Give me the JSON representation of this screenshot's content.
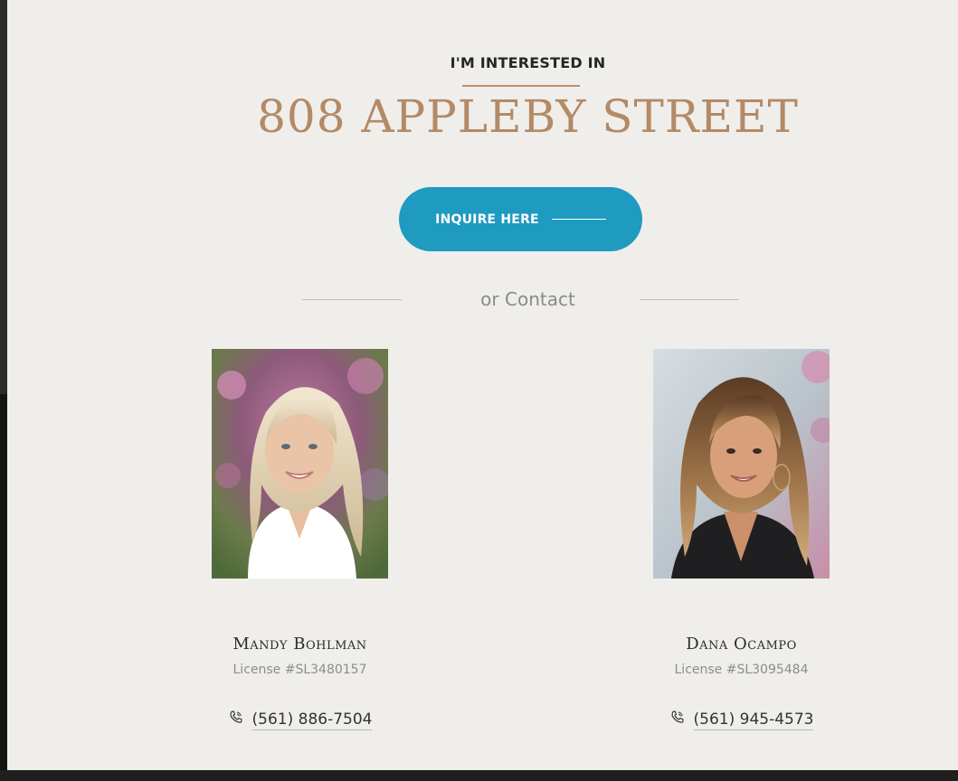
{
  "header": {
    "eyebrow": "I'M INTERESTED IN",
    "address": "808 APPLEBY STREET"
  },
  "cta": {
    "inquire_label": "INQUIRE HERE",
    "divider_label": "or Contact"
  },
  "colors": {
    "accent_gold": "#b38a66",
    "button_blue": "#1f9ac0",
    "panel_bg": "#efeeeb"
  },
  "agents": [
    {
      "name": "Mandy Bohlman",
      "license": "License #SL3480157",
      "phone": "(561) 886-7504",
      "phone_icon": "phone-icon"
    },
    {
      "name": "Dana Ocampo",
      "license": "License #SL3095484",
      "phone": "(561) 945-4573",
      "phone_icon": "phone-icon"
    }
  ]
}
